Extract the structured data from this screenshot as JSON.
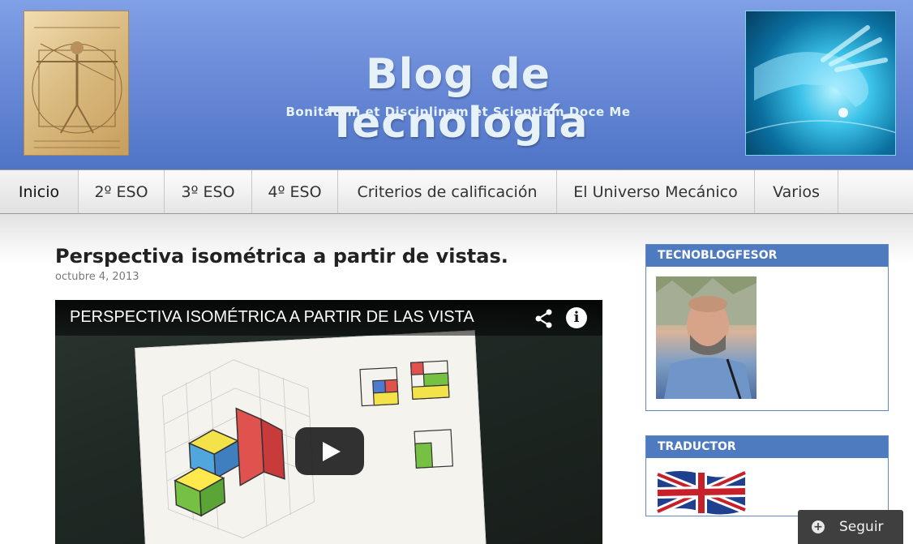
{
  "header": {
    "title": "Blog de Tecnología",
    "tagline": "Bonitatem et Disciplinam et Scientiam Doce Me",
    "left_image_icon": "vitruvian-man-image",
    "right_image_icon": "digital-hand-image"
  },
  "nav": {
    "items": [
      {
        "label": "Inicio",
        "active": true
      },
      {
        "label": "2º ESO"
      },
      {
        "label": "3º ESO"
      },
      {
        "label": "4º ESO"
      },
      {
        "label": "Criterios de calificación"
      },
      {
        "label": "El Universo Mecánico"
      },
      {
        "label": "Varios"
      }
    ]
  },
  "post": {
    "title": "Perspectiva isométrica a partir de vistas.",
    "date": "octubre 4, 2013",
    "video": {
      "title": "PERSPECTIVA ISOMÉTRICA A PARTIR DE LAS VISTA",
      "share_icon": "share-icon",
      "info_icon": "info-icon",
      "info_glyph": "i",
      "play_icon": "play-icon"
    }
  },
  "sidebar": {
    "profile_widget": {
      "title": "TECNOBLOGFESOR",
      "photo": "profile-photo"
    },
    "translate_widget": {
      "title": "TRADUCTOR",
      "flag": "uk-flag-icon"
    }
  },
  "follow": {
    "label": "Seguir",
    "icon": "plus-circle-icon",
    "icon_glyph": "+"
  },
  "colors": {
    "header_blue": "#5a7fd0",
    "widget_header": "#4e7bc0",
    "title_text": "#e6f2f7"
  }
}
